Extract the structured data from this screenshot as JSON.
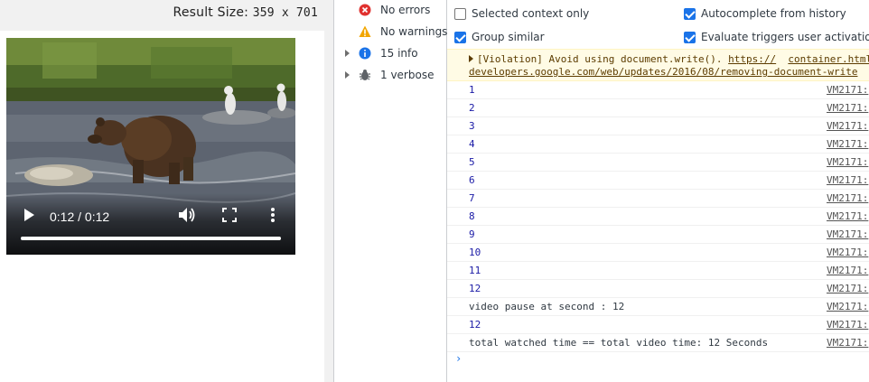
{
  "result": {
    "size_label": "Result Size:",
    "size_value": "359 x 701"
  },
  "video": {
    "time": "0:12 / 0:12",
    "progress": 1.0
  },
  "sidebar": {
    "filters": [
      {
        "label": "No errors",
        "icon": "error-icon",
        "expandable": false
      },
      {
        "label": "No warnings",
        "icon": "warning-icon",
        "expandable": false
      },
      {
        "label": "15 info",
        "icon": "info-icon",
        "expandable": true
      },
      {
        "label": "1 verbose",
        "icon": "verbose-bug-icon",
        "expandable": true
      }
    ]
  },
  "settings": {
    "selected_context_only": {
      "label": "Selected context only",
      "checked": false
    },
    "group_similar": {
      "label": "Group similar",
      "checked": true
    },
    "autocomplete_history": {
      "label": "Autocomplete from history",
      "checked": true
    },
    "evaluate_triggers": {
      "label": "Evaluate triggers user activation",
      "checked": true
    }
  },
  "violation": {
    "text": "[Violation] Avoid using document.write().",
    "link1": "https://",
    "source": "container.html",
    "link2": "developers.google.com/web/updates/2016/08/removing-document-write"
  },
  "logs": [
    {
      "msg": "1",
      "src": "VM2171:",
      "numeric": true
    },
    {
      "msg": "2",
      "src": "VM2171:",
      "numeric": true
    },
    {
      "msg": "3",
      "src": "VM2171:",
      "numeric": true
    },
    {
      "msg": "4",
      "src": "VM2171:",
      "numeric": true
    },
    {
      "msg": "5",
      "src": "VM2171:",
      "numeric": true
    },
    {
      "msg": "6",
      "src": "VM2171:",
      "numeric": true
    },
    {
      "msg": "7",
      "src": "VM2171:",
      "numeric": true
    },
    {
      "msg": "8",
      "src": "VM2171:",
      "numeric": true
    },
    {
      "msg": "9",
      "src": "VM2171:",
      "numeric": true
    },
    {
      "msg": "10",
      "src": "VM2171:",
      "numeric": true
    },
    {
      "msg": "11",
      "src": "VM2171:",
      "numeric": true
    },
    {
      "msg": "12",
      "src": "VM2171:",
      "numeric": true
    },
    {
      "msg": "video pause at second : 12",
      "src": "VM2171:",
      "numeric": false
    },
    {
      "msg": "12",
      "src": "VM2171:",
      "numeric": true
    },
    {
      "msg": "total watched time == total video time: 12 Seconds",
      "src": "VM2171:",
      "numeric": false
    }
  ],
  "prompt": {
    "caret": "›"
  },
  "colors": {
    "accent": "#1a73e8",
    "error": "#e0312f",
    "warning": "#f2a600",
    "info": "#1a73e8",
    "violation_bg": "#fffbe5"
  }
}
